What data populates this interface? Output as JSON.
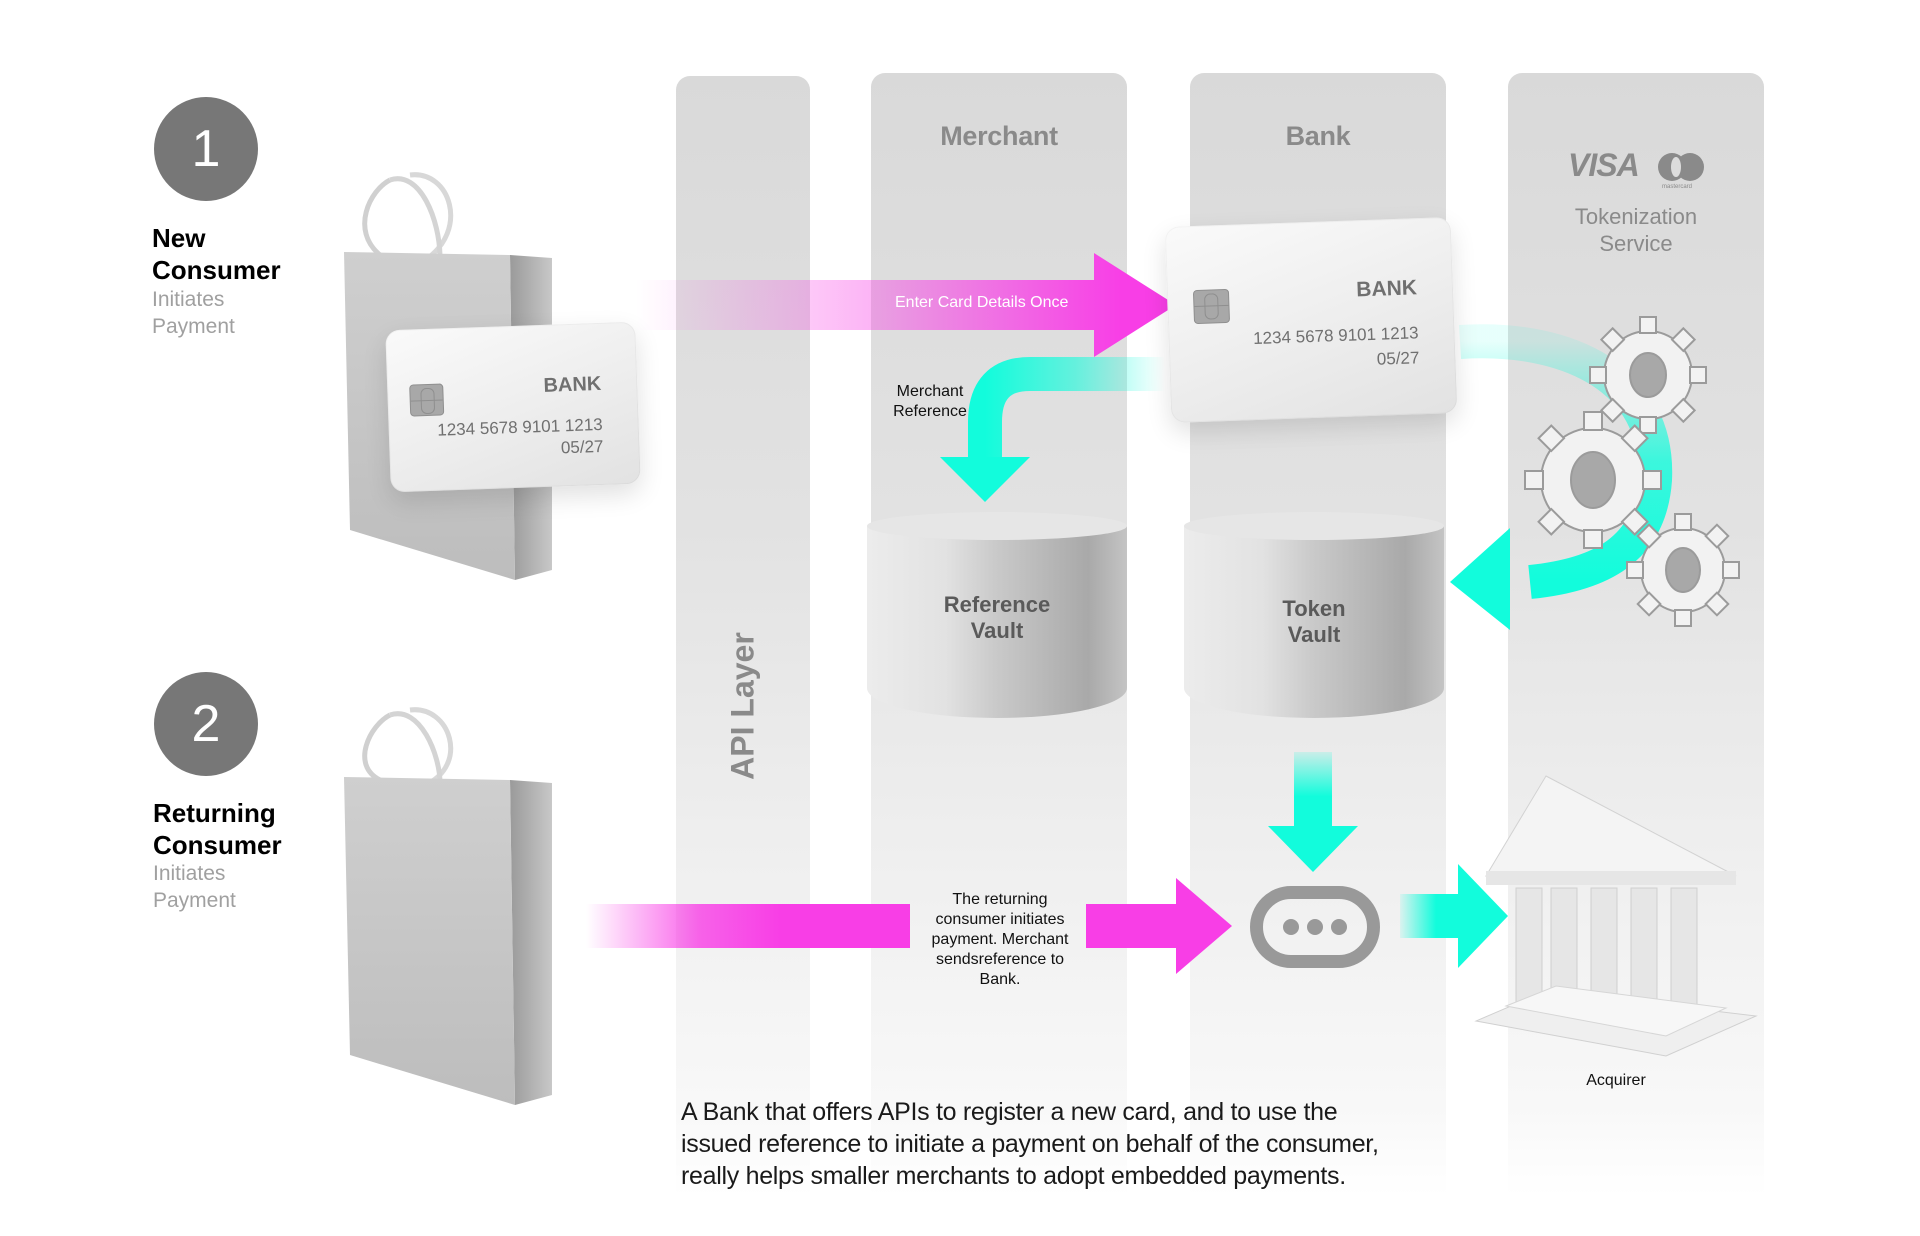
{
  "steps": [
    {
      "number": "1",
      "title_line1": "New",
      "title_line2": "Consumer",
      "sub_line1": "Initiates",
      "sub_line2": "Payment"
    },
    {
      "number": "2",
      "title_line1": "Returning",
      "title_line2": "Consumer",
      "sub_line1": "Initiates",
      "sub_line2": "Payment"
    }
  ],
  "lanes": {
    "api": {
      "label": "API Layer"
    },
    "merchant": {
      "title": "Merchant"
    },
    "bank": {
      "title": "Bank"
    },
    "tokenization": {
      "visa": "VISA",
      "mastercard": "mastercard",
      "title_line1": "Tokenization",
      "title_line2": "Service"
    }
  },
  "cards": [
    {
      "bank": "BANK",
      "number": "1234 5678 9101 1213",
      "expiry": "05/27"
    },
    {
      "bank": "BANK",
      "number": "1234 5678 9101 1213",
      "expiry": "05/27"
    }
  ],
  "arrows": {
    "enter_card": "Enter Card Details Once",
    "merchant_reference_line1": "Merchant",
    "merchant_reference_line2": "Reference",
    "returning_line1": "The returning",
    "returning_line2": "consumer initiates",
    "returning_line3": "payment. Merchant",
    "returning_line4": "sendsreference to",
    "returning_line5": "Bank."
  },
  "vaults": {
    "reference": {
      "line1": "Reference",
      "line2": "Vault"
    },
    "token": {
      "line1": "Token",
      "line2": "Vault"
    }
  },
  "acquirer": {
    "label": "Acquirer"
  },
  "caption": {
    "line1": "A Bank that offers APIs to register a new card, and to use the",
    "line2": "issued reference to initiate a payment on behalf of the consumer,",
    "line3": "really helps smaller merchants to adopt embedded payments."
  },
  "colors": {
    "magenta": "#f83ee6",
    "cyan": "#12fcdc",
    "lane": "#d9d9d9",
    "step_circle": "#777777",
    "label_gray": "#8a8a8a"
  }
}
